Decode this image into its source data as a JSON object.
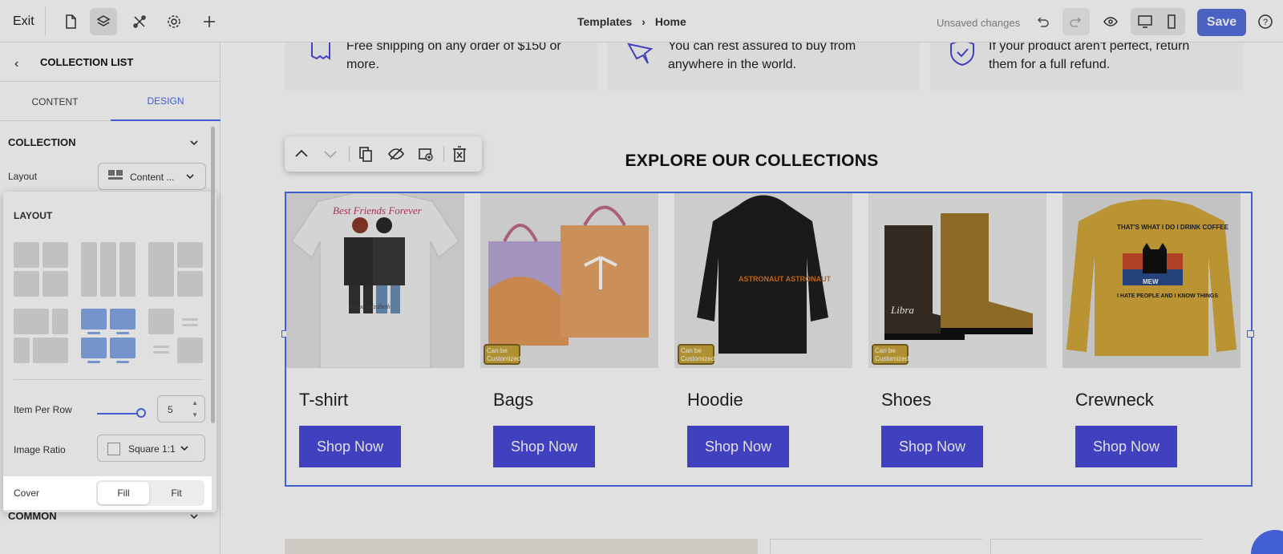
{
  "topbar": {
    "exit_label": "Exit",
    "breadcrumb": [
      "Templates",
      "Home"
    ],
    "unsaved_label": "Unsaved changes",
    "save_label": "Save",
    "help_label": "?"
  },
  "sidebar": {
    "title": "COLLECTION LIST",
    "tabs": [
      "CONTENT",
      "DESIGN"
    ],
    "active_tab": "DESIGN",
    "section_title": "COLLECTION",
    "layout_label": "Layout",
    "layout_value": "Content ...",
    "panel_title": "LAYOUT",
    "item_per_row_label": "Item Per Row",
    "item_per_row_value": "5",
    "image_ratio_label": "Image Ratio",
    "image_ratio_value": "Square 1:1",
    "cover_label": "Cover",
    "cover_options": [
      "Fill",
      "Fit"
    ],
    "cover_selected": "Fill",
    "common_label": "COMMON"
  },
  "features": [
    {
      "text_1": "Free shipping on any order of $150 or",
      "text_2": "more.",
      "icon": "receipt-icon"
    },
    {
      "text_1": "You can rest assured to buy from",
      "text_2": "anywhere in the world.",
      "icon": "plane-icon"
    },
    {
      "text_1": "If your product aren't perfect, return",
      "text_2": "them for a full refund.",
      "icon": "shield-icon"
    }
  ],
  "heading": "EXPLORE OUR COLLECTIONS",
  "collections": [
    {
      "title": "T-shirt",
      "button": "Shop Now",
      "badge": ""
    },
    {
      "title": "Bags",
      "button": "Shop Now",
      "badge": "Can be Customized"
    },
    {
      "title": "Hoodie",
      "button": "Shop Now",
      "badge": "Can be Customized"
    },
    {
      "title": "Shoes",
      "button": "Shop Now",
      "badge": "Can be Customized"
    },
    {
      "title": "Crewneck",
      "button": "Shop Now",
      "badge": ""
    }
  ],
  "image_texts": {
    "tshirt_script": "Best Friends Forever",
    "tshirt_names": "Diane  Elizabeth",
    "hoodie_text": "ASTRONAUT ASTRONAUT",
    "shoe_text": "Libra",
    "crew_top": "THAT'S WHAT I DO I DRINK COFFEE",
    "crew_meow": "MEW",
    "crew_bottom": "I HATE PEOPLE AND I KNOW THINGS"
  },
  "colors": {
    "accent": "#4a6cf0",
    "shop_button": "#4a4bdb",
    "save": "#5470e0"
  }
}
